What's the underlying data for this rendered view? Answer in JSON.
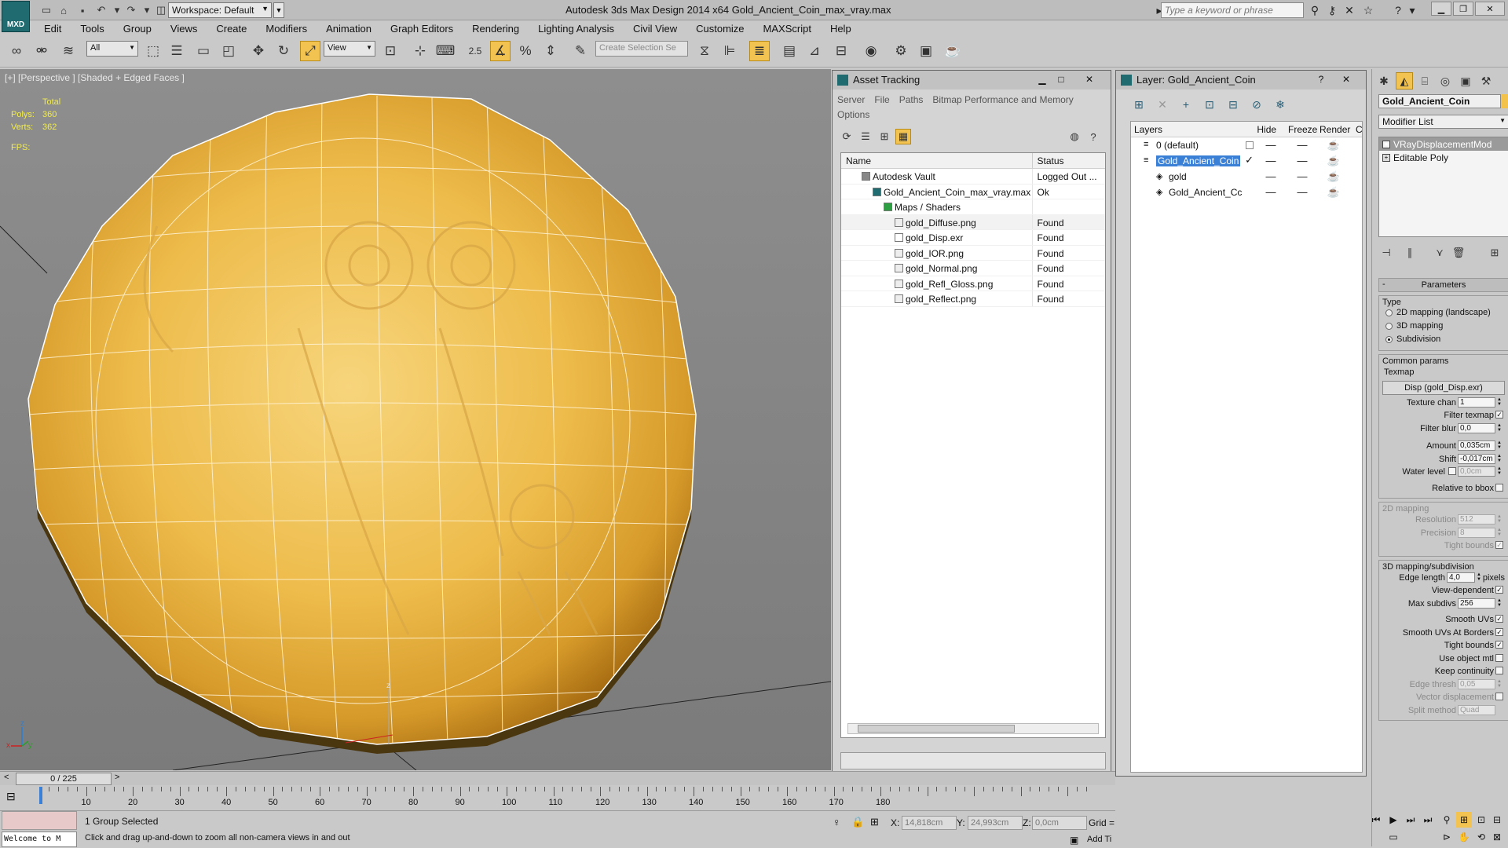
{
  "app": {
    "logo_text": "MXD",
    "workspace": "Workspace: Default",
    "title": "Autodesk 3ds Max Design 2014 x64     Gold_Ancient_Coin_max_vray.max",
    "search_placeholder": "Type a keyword or phrase"
  },
  "menu": [
    "Edit",
    "Tools",
    "Group",
    "Views",
    "Create",
    "Modifiers",
    "Animation",
    "Graph Editors",
    "Rendering",
    "Lighting Analysis",
    "Civil View",
    "Customize",
    "MAXScript",
    "Help"
  ],
  "toolbar": {
    "selection_filter": "All",
    "ref_coord": "View",
    "snap_value": "2.5",
    "selection_set_placeholder": "Create Selection Se"
  },
  "viewport": {
    "label": "[+] [Perspective ] [Shaded + Edged Faces ]",
    "stats_header": "Total",
    "polys_label": "Polys:",
    "polys_value": "360",
    "verts_label": "Verts:",
    "verts_value": "362",
    "fps_label": "FPS:",
    "gizmo_z": "z",
    "axis_x": "x",
    "axis_y": "y",
    "axis_z": "z"
  },
  "asset_tracking": {
    "title": "Asset Tracking",
    "menu": [
      "Server",
      "File",
      "Paths",
      "Bitmap Performance and Memory",
      "Options"
    ],
    "col_name": "Name",
    "col_status": "Status",
    "rows": [
      {
        "name": "Autodesk Vault",
        "status": "Logged Out ...",
        "indent": 0,
        "icon": "vault-icon"
      },
      {
        "name": "Gold_Ancient_Coin_max_vray.max",
        "status": "Ok",
        "indent": 1,
        "icon": "max-file-icon"
      },
      {
        "name": "Maps / Shaders",
        "status": "",
        "indent": 2,
        "icon": "folder-icon"
      },
      {
        "name": "gold_Diffuse.png",
        "status": "Found",
        "indent": 3,
        "icon": "image-file-icon"
      },
      {
        "name": "gold_Disp.exr",
        "status": "Found",
        "indent": 3,
        "icon": "blank-file-icon"
      },
      {
        "name": "gold_IOR.png",
        "status": "Found",
        "indent": 3,
        "icon": "image-file-icon"
      },
      {
        "name": "gold_Normal.png",
        "status": "Found",
        "indent": 3,
        "icon": "image-file-icon"
      },
      {
        "name": "gold_Refl_Gloss.png",
        "status": "Found",
        "indent": 3,
        "icon": "image-file-icon"
      },
      {
        "name": "gold_Reflect.png",
        "status": "Found",
        "indent": 3,
        "icon": "image-file-icon"
      }
    ]
  },
  "layers": {
    "title": "Layer: Gold_Ancient_Coin",
    "col_layers": "Layers",
    "col_hide": "Hide",
    "col_freeze": "Freeze",
    "col_render": "Render",
    "col_extra": "C",
    "rows": [
      {
        "name": "0 (default)",
        "indent": 0
      },
      {
        "name": "Gold_Ancient_Coin",
        "indent": 0
      },
      {
        "name": "gold",
        "indent": 1
      },
      {
        "name": "Gold_Ancient_Cc",
        "indent": 1
      }
    ]
  },
  "command_panel": {
    "object_name": "Gold_Ancient_Coin",
    "object_color": "#f3c24a",
    "modifier_list": "Modifier List",
    "stack": [
      "VRayDisplacementMod",
      "Editable Poly"
    ],
    "parameters_title": "Parameters",
    "type_label": "Type",
    "type_options": [
      "2D mapping (landscape)",
      "3D mapping",
      "Subdivision"
    ],
    "common_params": "Common params",
    "texmap_label": "Texmap",
    "texmap_value": "Disp (gold_Disp.exr)",
    "texture_chan_label": "Texture chan",
    "texture_chan_value": "1",
    "filter_texmap_label": "Filter texmap",
    "filter_blur_label": "Filter blur",
    "filter_blur_value": "0,0",
    "amount_label": "Amount",
    "amount_value": "0,035cm",
    "shift_label": "Shift",
    "shift_value": "-0,017cm",
    "water_level_label": "Water level",
    "water_level_value": "0,0cm",
    "relative_bbox_label": "Relative to bbox",
    "mapping2d_title": "2D mapping",
    "resolution_label": "Resolution",
    "resolution_value": "512",
    "precision_label": "Precision",
    "precision_value": "8",
    "tight_bounds_label": "Tight bounds",
    "mapping3d_title": "3D mapping/subdivision",
    "edge_length_label": "Edge length",
    "edge_length_value": "4,0",
    "pixels_label": "pixels",
    "view_dependent_label": "View-dependent",
    "max_subdivs_label": "Max subdivs",
    "max_subdivs_value": "256",
    "smooth_uvs_label": "Smooth UVs",
    "smooth_uvs_borders_label": "Smooth UVs At Borders",
    "tight_bounds2_label": "Tight bounds",
    "use_object_mtl_label": "Use object mtl",
    "keep_continuity_label": "Keep continuity",
    "edge_thresh_label": "Edge thresh",
    "edge_thresh_value": "0,05",
    "vector_disp_label": "Vector displacement",
    "split_method_label": "Split method",
    "split_method_value": "Quad"
  },
  "timeline": {
    "frame_display": "0 / 225",
    "ticks": [
      "10",
      "20",
      "30",
      "40",
      "50",
      "60",
      "70",
      "80",
      "90",
      "100",
      "110",
      "120",
      "130",
      "140",
      "150",
      "160",
      "170",
      "180"
    ]
  },
  "status": {
    "welcome": "Welcome to M",
    "selected": "1 Group Selected",
    "prompt": "Click and drag up-and-down to zoom all non-camera views in and out",
    "x_label": "X:",
    "x_value": "14,818cm",
    "y_label": "Y:",
    "y_value": "24,993cm",
    "z_label": "Z:",
    "z_value": "0,0cm",
    "grid_label": "Grid =",
    "add_time_tag": "Add Ti"
  }
}
